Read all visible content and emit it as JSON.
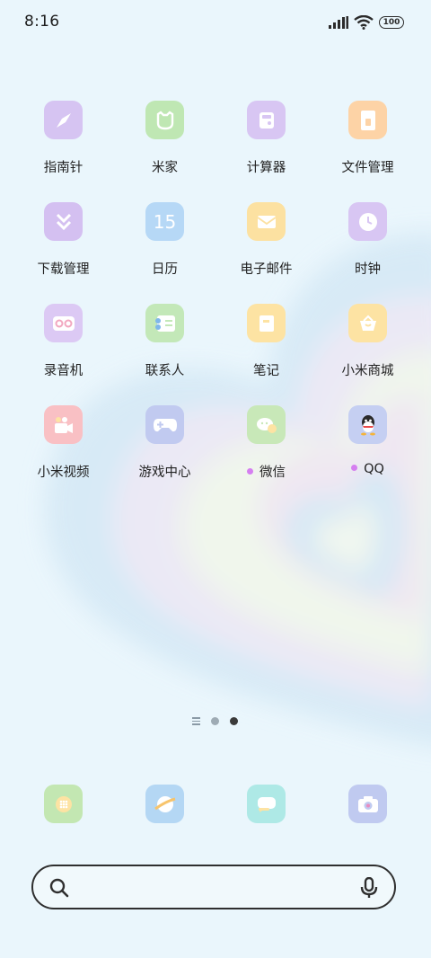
{
  "status": {
    "time": "8:16",
    "battery": "100"
  },
  "apps": [
    {
      "label": "指南针",
      "icon": "compass-icon",
      "color": "#d6c4f2",
      "dot": false
    },
    {
      "label": "米家",
      "icon": "mijia-icon",
      "color": "#bfe7b3",
      "dot": false
    },
    {
      "label": "计算器",
      "icon": "calculator-icon",
      "color": "#d8c6f3",
      "dot": false
    },
    {
      "label": "文件管理",
      "icon": "file-manager-icon",
      "color": "#fdd3a6",
      "dot": false
    },
    {
      "label": "下载管理",
      "icon": "download-icon",
      "color": "#d4c0f1",
      "dot": false
    },
    {
      "label": "日历",
      "icon": "calendar-icon",
      "color": "#b6d8f6",
      "dot": false,
      "text": "15"
    },
    {
      "label": "电子邮件",
      "icon": "email-icon",
      "color": "#fce1a1",
      "dot": false
    },
    {
      "label": "时钟",
      "icon": "clock-icon",
      "color": "#d8c6f3",
      "dot": false
    },
    {
      "label": "录音机",
      "icon": "recorder-icon",
      "color": "#dcc9f4",
      "dot": false
    },
    {
      "label": "联系人",
      "icon": "contacts-icon",
      "color": "#c3e8b8",
      "dot": false
    },
    {
      "label": "笔记",
      "icon": "notes-icon",
      "color": "#fde3a3",
      "dot": false
    },
    {
      "label": "小米商城",
      "icon": "shop-icon",
      "color": "#fde3a3",
      "dot": false
    },
    {
      "label": "小米视频",
      "icon": "video-icon",
      "color": "#f9c0c4",
      "dot": false
    },
    {
      "label": "游戏中心",
      "icon": "gamepad-icon",
      "color": "#c1caf0",
      "dot": false
    },
    {
      "label": "微信",
      "icon": "wechat-icon",
      "color": "#c8e8b8",
      "dot": true
    },
    {
      "label": "QQ",
      "icon": "qq-icon",
      "color": "#c5cff2",
      "dot": true
    }
  ],
  "dock": [
    {
      "icon": "phone-icon",
      "color": "#c3e7b2"
    },
    {
      "icon": "browser-icon",
      "color": "#b4d7f4"
    },
    {
      "icon": "messages-icon",
      "color": "#aee9e6"
    },
    {
      "icon": "camera-icon",
      "color": "#c0caf0"
    }
  ],
  "page_indicator": {
    "pages": 2,
    "current": 2
  },
  "search": {
    "placeholder": ""
  }
}
